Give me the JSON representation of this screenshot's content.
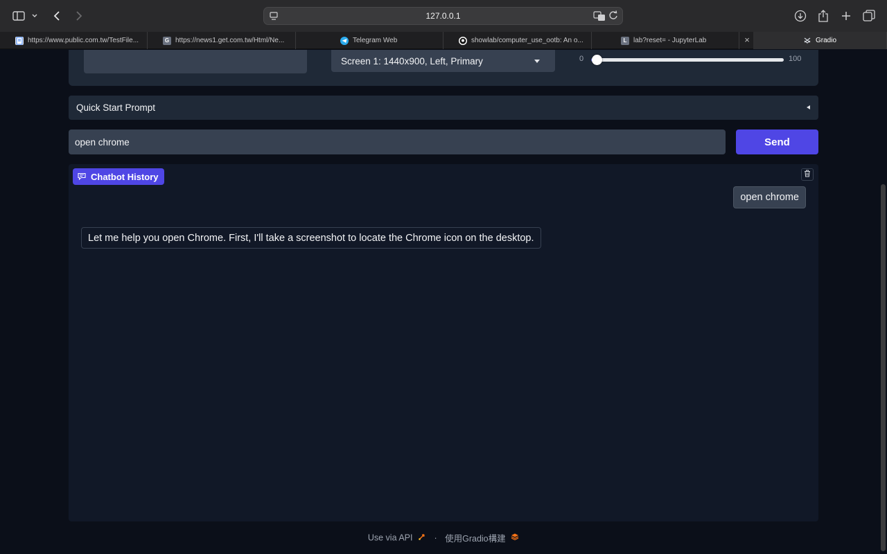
{
  "browser": {
    "address": "127.0.0.1",
    "tabs": [
      {
        "label": "https://www.public.com.tw/TestFile...",
        "favicon": "doc-icon",
        "color": "#3b82f6"
      },
      {
        "label": "https://news1.get.com.tw/Html/Ne...",
        "favicon": "G",
        "color": "#6b7280"
      },
      {
        "label": "Telegram Web",
        "favicon": "telegram-icon",
        "color": "#2aabee"
      },
      {
        "label": "showlab/computer_use_ootb: An o...",
        "favicon": "github-icon",
        "color": "#ffffff"
      },
      {
        "label": "lab?reset= - JupyterLab",
        "favicon": "L",
        "color": "#6b7280"
      },
      {
        "label": "Gradio",
        "favicon": "gradio-icon",
        "color": "#f97316",
        "active": true
      }
    ]
  },
  "settings": {
    "screen_select": "Screen 1: 1440x900, Left, Primary",
    "slider_min": "0",
    "slider_max": "100",
    "slider_value": 3
  },
  "accordion": {
    "label": "Quick Start Prompt"
  },
  "prompt": {
    "value": "open chrome"
  },
  "send": {
    "label": "Send"
  },
  "chat": {
    "label": "Chatbot History",
    "messages": [
      {
        "role": "user",
        "text": "open chrome"
      },
      {
        "role": "assistant",
        "text": "Let me help you open Chrome. First, I'll take a screenshot to locate the Chrome icon on the desktop."
      }
    ]
  },
  "footer": {
    "api": "Use via API",
    "sep": "·",
    "built": "使用Gradio構建"
  },
  "colors": {
    "accent": "#4f46e5",
    "panel": "#1f2937",
    "bg": "#0b0f19"
  }
}
